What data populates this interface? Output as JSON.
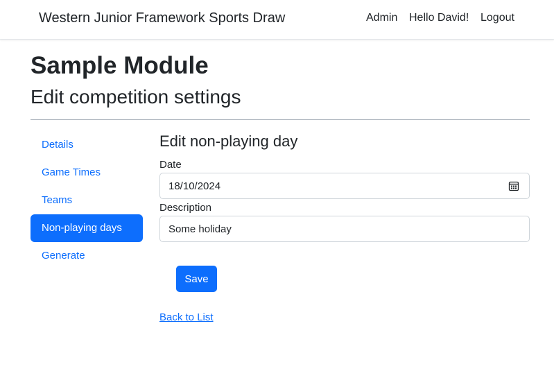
{
  "navbar": {
    "brand": "Western Junior Framework Sports Draw",
    "links": [
      "Admin",
      "Hello David!",
      "Logout"
    ]
  },
  "page": {
    "title": "Sample Module",
    "subtitle": "Edit competition settings"
  },
  "sidebar": {
    "items": [
      {
        "label": "Details",
        "active": false
      },
      {
        "label": "Game Times",
        "active": false
      },
      {
        "label": "Teams",
        "active": false
      },
      {
        "label": "Non-playing days",
        "active": true
      },
      {
        "label": "Generate",
        "active": false
      }
    ]
  },
  "form": {
    "title": "Edit non-playing day",
    "date_label": "Date",
    "date_value": "18/10/2024",
    "description_label": "Description",
    "description_value": "Some holiday",
    "save_label": "Save",
    "back_label": "Back to List"
  },
  "colors": {
    "primary": "#0d6efd",
    "text": "#212529",
    "border": "#ced4da"
  },
  "icons": {
    "date_picker": "calendar-icon"
  }
}
